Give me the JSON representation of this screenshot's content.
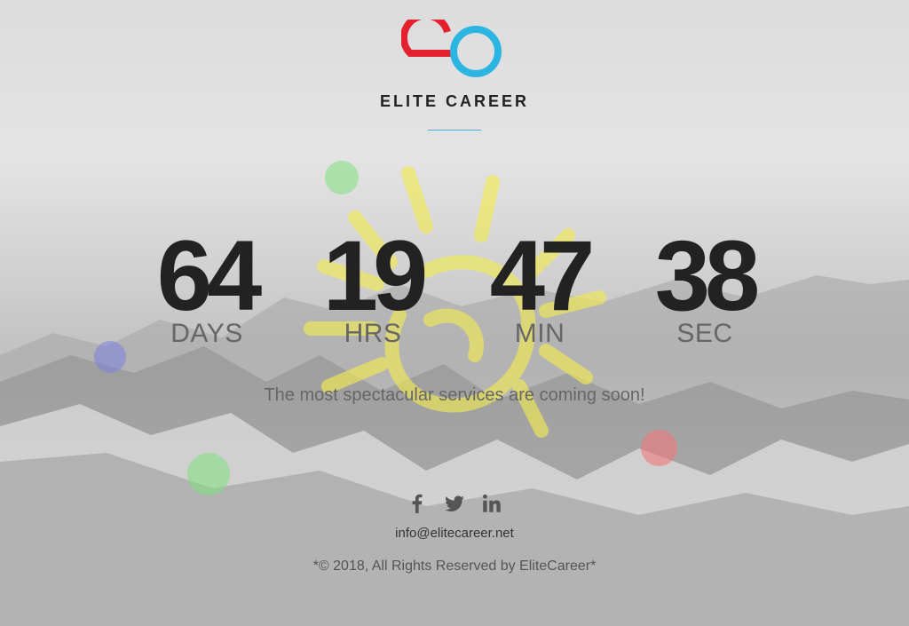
{
  "brand": {
    "name": "ELITE CAREER",
    "logo_colors": {
      "e": "#e3212f",
      "o": "#2bb5e2"
    },
    "accent": "#3bb6e0"
  },
  "countdown": [
    {
      "value": "64",
      "label": "DAYS"
    },
    {
      "value": "19",
      "label": "HRS"
    },
    {
      "value": "47",
      "label": "MIN"
    },
    {
      "value": "38",
      "label": "SEC"
    }
  ],
  "tagline": "The most spectacular services are coming soon!",
  "social": [
    {
      "icon": "facebook-icon"
    },
    {
      "icon": "twitter-icon"
    },
    {
      "icon": "linkedin-icon"
    }
  ],
  "contact": {
    "email": "info@elitecareer.net"
  },
  "footer": {
    "copyright": "*© 2018, All Rights Reserved by EliteCareer*"
  },
  "decor_colors": {
    "green": "#7ee07e",
    "blue": "#7b7fe0",
    "red": "#f07a7a",
    "yellow": "#f2ea55"
  }
}
